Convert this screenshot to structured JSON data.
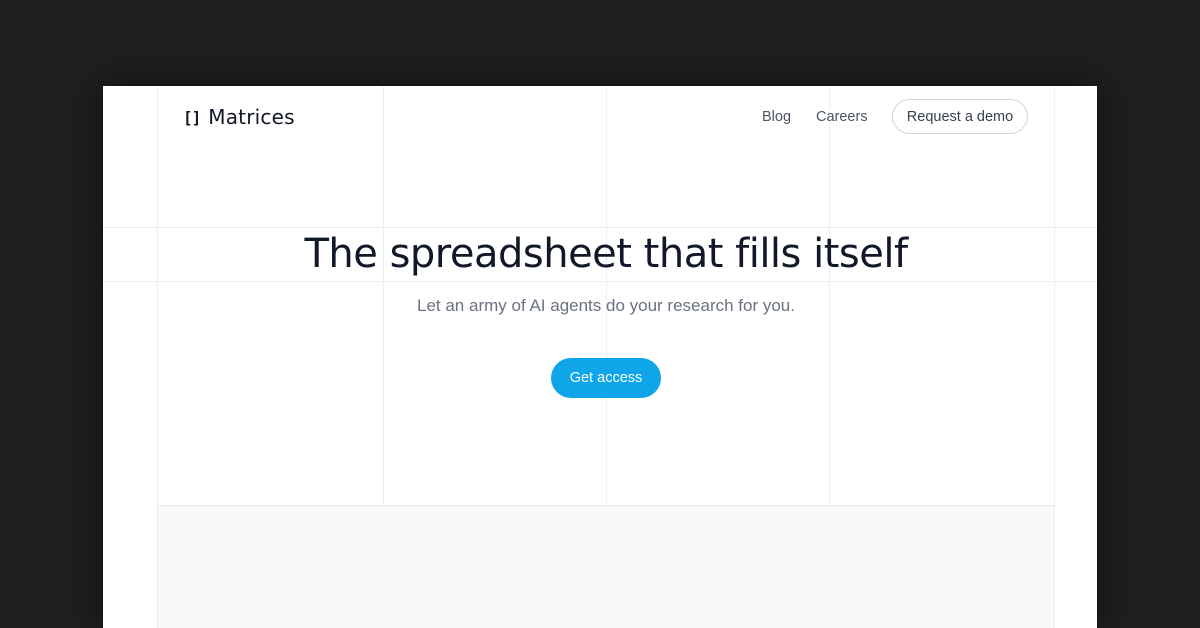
{
  "brand": {
    "logo_mark": "[]",
    "name": "Matrices"
  },
  "nav": {
    "links": [
      {
        "label": "Blog"
      },
      {
        "label": "Careers"
      }
    ],
    "demo_button": "Request a demo"
  },
  "hero": {
    "title": "The spreadsheet that fills itself",
    "subtitle": "Let an army of AI agents do your research for you.",
    "cta": "Get access"
  },
  "colors": {
    "backdrop": "#1f1f22",
    "accent": "#0ea5e9",
    "heading": "#111827",
    "muted": "#6b7280"
  }
}
